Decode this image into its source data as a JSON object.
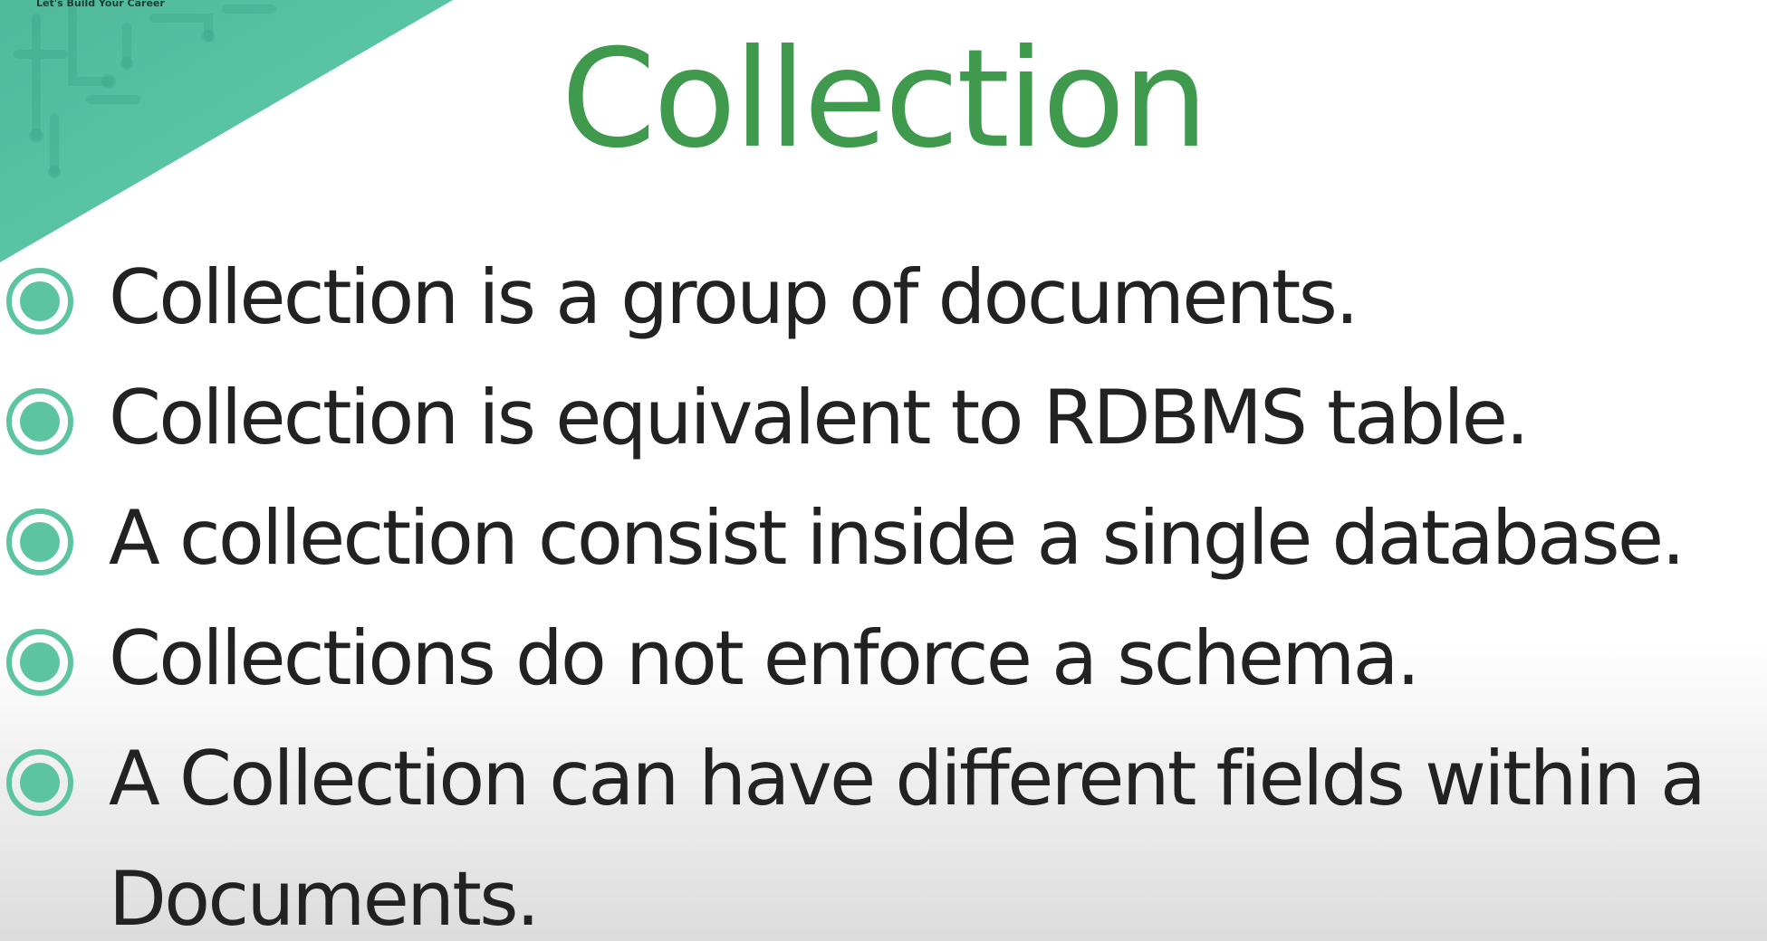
{
  "slide": {
    "tagline": "Let's Build Your Career",
    "title": "Collection",
    "bullets": [
      {
        "text": "Collection is a group of documents."
      },
      {
        "text": "Collection is equivalent to RDBMS table."
      },
      {
        "text": "A collection consist inside a single database."
      },
      {
        "text": "Collections do not enforce a schema."
      },
      {
        "line1": "A Collection can have different fields within a",
        "line2": "Documents."
      }
    ]
  },
  "colors": {
    "title": "#3f9a4e",
    "accent_teal": "#5cc4a0",
    "text": "#222222"
  },
  "icons": {
    "bullet": "radio-bullet-icon",
    "corner": "circuit-triangle-decoration"
  }
}
